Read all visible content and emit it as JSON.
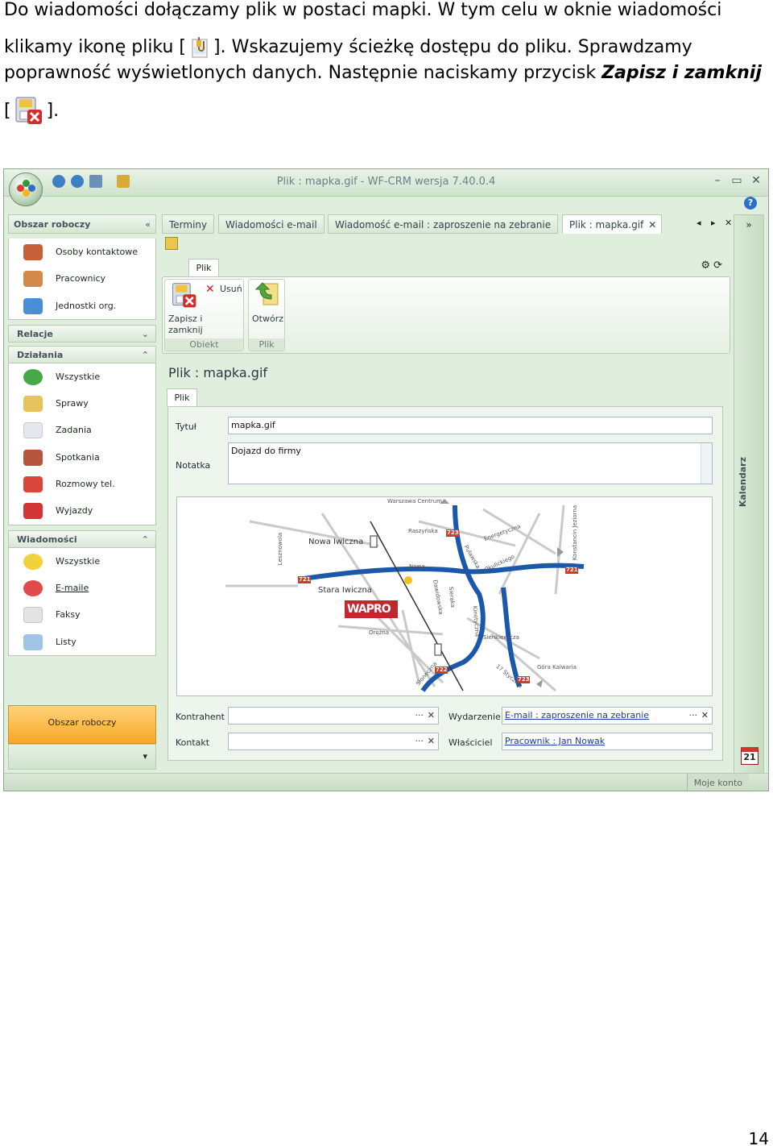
{
  "doc": {
    "line1": "Do wiadomości dołączamy plik w postaci mapki. W tym celu w oknie wiadomości",
    "line2a": "klikamy ikonę pliku [",
    "line2b": "]. Wskazujemy ścieżkę dostępu do pliku. Sprawdzamy",
    "line3a": "poprawność wyświetlonych danych. Następnie naciskamy przycisk ",
    "line3b": "Zapisz i zamknij",
    "line4a": "[",
    "line4b": "].",
    "page_number": "14"
  },
  "window": {
    "title": "Plik : mapka.gif - WF-CRM wersja 7.40.0.4",
    "minimize": "–",
    "maximize": "▭",
    "close": "✕",
    "help": "?"
  },
  "nav": {
    "workspace_header": "Obszar roboczy",
    "workspace_items": [
      "Osoby kontaktowe",
      "Pracownicy",
      "Jednostki org."
    ],
    "relations_header": "Relacje",
    "actions_header": "Działania",
    "actions_items": [
      "Wszystkie",
      "Sprawy",
      "Zadania",
      "Spotkania",
      "Rozmowy tel.",
      "Wyjazdy"
    ],
    "messages_header": "Wiadomości",
    "messages_items": [
      "Wszystkie",
      "E-maile",
      "Faksy",
      "Listy"
    ],
    "bottom_button": "Obszar roboczy",
    "collapse": "«",
    "expand_down": "»",
    "collapse_up": "»"
  },
  "tabs": [
    "Terminy",
    "Wiadomości e-mail",
    "Wiadomość e-mail : zaproszenie na zebranie",
    "Plik : mapka.gif"
  ],
  "tab_close": "✕",
  "tab_prev": "◂",
  "tab_next": "▸",
  "tab_close_all": "✕",
  "tab_overflow": "»",
  "ribbon": {
    "tab": "Plik",
    "save_close": "Zapisz i zamknij",
    "delete": "Usuń",
    "open": "Otwórz",
    "group_object": "Obiekt",
    "group_file": "Plik"
  },
  "form": {
    "title": "Plik : mapka.gif",
    "tab": "Plik",
    "title_label": "Tytuł",
    "title_value": "mapka.gif",
    "note_label": "Notatka",
    "note_value": "Dojazd do firmy",
    "contractor_label": "Kontrahent",
    "contact_label": "Kontakt",
    "event_label": "Wydarzenie",
    "event_value": "E-mail : zaproszenie na zebranie",
    "owner_label": "Właściciel",
    "owner_value": "Pracownik : Jan Nowak",
    "ellipsis": "···",
    "clear": "✕"
  },
  "map": {
    "labels": [
      "Warszawa Centrum",
      "Nowa Iwiczna",
      "Stara Iwiczna",
      "Raszyńska",
      "Energetyczna",
      "Puławska",
      "Okulickiego",
      "Nowa",
      "Dawidowska",
      "Kinetyczna",
      "Lesznowola",
      "Konstancin Jeziorna",
      "Orężna",
      "Sienkiewicza",
      "Słoneczna",
      "17 Stycznia",
      "Góra Kalwaria",
      "Sieraka"
    ],
    "road_numbers": [
      "721",
      "721",
      "722",
      "723",
      "722",
      "723"
    ],
    "logo": "WAPRO"
  },
  "right_rail": {
    "top": "»",
    "label": "Kalendarz",
    "calendar_day": "21"
  },
  "status": {
    "account": "Moje konto"
  },
  "colors": {
    "road": "#1b58a9",
    "accent_orange": "#f6a826",
    "chrome_green": "#dfeedd",
    "link": "#1b3aa5"
  }
}
